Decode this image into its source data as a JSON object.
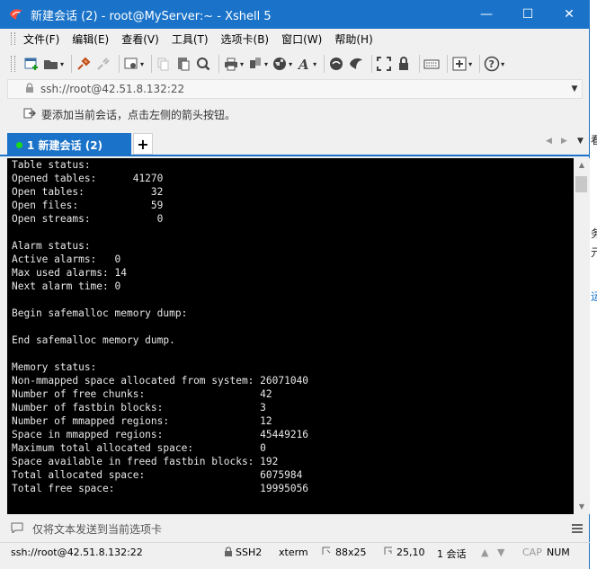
{
  "window": {
    "title": "新建会话 (2) - root@MyServer:~ - Xshell 5",
    "controls": {
      "minimize": "—",
      "maximize": "☐",
      "close": "✕"
    }
  },
  "menu": [
    "文件(F)",
    "编辑(E)",
    "查看(V)",
    "工具(T)",
    "选项卡(B)",
    "窗口(W)",
    "帮助(H)"
  ],
  "address": {
    "value": "ssh://root@42.51.8.132:22"
  },
  "hint": {
    "text": "要添加当前会话，点击左侧的箭头按钮。"
  },
  "tabs": {
    "active_label": "1 新建会话 (2)",
    "add": "+"
  },
  "terminal": {
    "lines": [
      "Table status:",
      "Opened tables:      41270",
      "Open tables:           32",
      "Open files:            59",
      "Open streams:           0",
      "",
      "Alarm status:",
      "Active alarms:   0",
      "Max used alarms: 14",
      "Next alarm time: 0",
      "",
      "Begin safemalloc memory dump:",
      "",
      "End safemalloc memory dump.",
      "",
      "Memory status:",
      "Non-mmapped space allocated from system: 26071040",
      "Number of free chunks:                   42",
      "Number of fastbin blocks:                3",
      "Number of mmapped regions:               12",
      "Space in mmapped regions:                45449216",
      "Maximum total allocated space:           0",
      "Space available in freed fastbin blocks: 192",
      "Total allocated space:                   6075984",
      "Total free space:                        19995056",
      ""
    ]
  },
  "compose": {
    "placeholder": "仅将文本发送到当前选项卡"
  },
  "status": {
    "connection": "ssh://root@42.51.8.132:22",
    "protocol": "SSH2",
    "terminal_type": "xterm",
    "size": "88x25",
    "cursor": "25,10",
    "sessions": "1 会话",
    "caps": "CAP",
    "num": "NUM"
  },
  "background_fragments": [
    "看",
    "务",
    "元",
    "运"
  ],
  "colors": {
    "accent": "#1a73c9",
    "terminal_bg": "#000000",
    "terminal_fg": "#e8e8e8",
    "tab_dot": "#1bd91b"
  }
}
